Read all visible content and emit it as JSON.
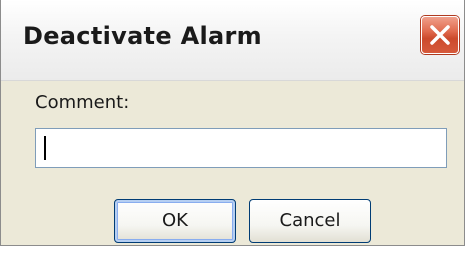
{
  "dialog": {
    "title": "Deactivate Alarm",
    "close_icon": "close-icon",
    "comment_label": "Comment:",
    "comment_value": "",
    "ok_label": "OK",
    "cancel_label": "Cancel"
  },
  "colors": {
    "window_background": "#ece9d8",
    "titlebar_background": "#f4f4f4",
    "close_button": "#d65a3c",
    "input_border": "#7f9db9",
    "button_border": "#003c74"
  }
}
